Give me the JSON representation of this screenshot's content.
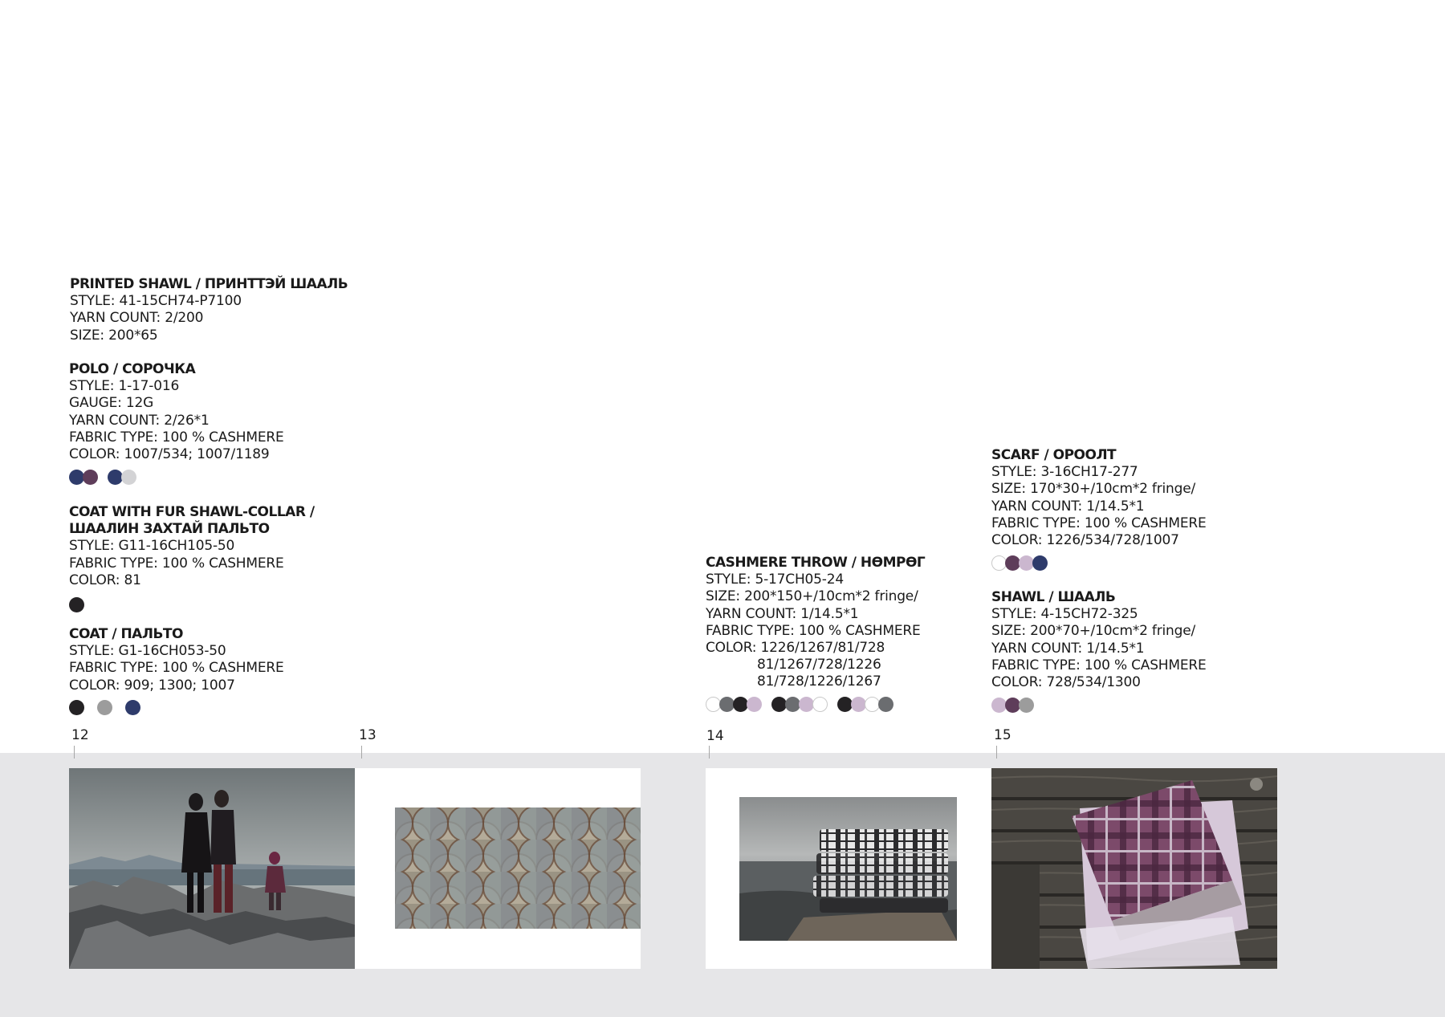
{
  "products": {
    "printed_shawl": {
      "title": "PRINTED SHAWL / ПРИНТТЭЙ ШААЛЬ",
      "style": "STYLE: 41-15CH74-P7100",
      "yarn": "YARN COUNT: 2/200",
      "size": "SIZE: 200*65"
    },
    "polo": {
      "title": "POLO / СОРОЧКА",
      "style": "STYLE: 1-17-016",
      "gauge": "GAUGE: 12G",
      "yarn": "YARN COUNT: 2/26*1",
      "fabric": "FABRIC TYPE: 100 % CASHMERE",
      "color": "COLOR: 1007/534; 1007/1189"
    },
    "coat_fur": {
      "title1": "COAT WITH FUR SHAWL-COLLAR /",
      "title2": "ШААЛИН ЗАХТАЙ ПАЛЬТО",
      "style": "STYLE: G11-16CH105-50",
      "fabric": "FABRIC TYPE: 100 % CASHMERE",
      "color": "COLOR: 81"
    },
    "coat": {
      "title": "COAT / ПАЛЬТО",
      "style": "STYLE: G1-16CH053-50",
      "fabric": "FABRIC TYPE: 100 % CASHMERE",
      "color": "COLOR: 909; 1300; 1007"
    },
    "throw": {
      "title": "CASHMERE THROW / НӨМРӨГ",
      "style": "STYLE: 5-17CH05-24",
      "size": "SIZE: 200*150+/10cm*2 fringe/",
      "yarn": "YARN COUNT: 1/14.5*1",
      "fabric": "FABRIC TYPE: 100 % CASHMERE",
      "color1": "COLOR: 1226/1267/81/728",
      "color2": "81/1267/728/1226",
      "color3": "81/728/1226/1267"
    },
    "scarf": {
      "title": "SCARF / ОРООЛТ",
      "style": "STYLE: 3-16CH17-277",
      "size": "SIZE: 170*30+/10cm*2 fringe/",
      "yarn": "YARN COUNT: 1/14.5*1",
      "fabric": "FABRIC TYPE: 100 % CASHMERE",
      "color": "COLOR: 1226/534/728/1007"
    },
    "shawl": {
      "title": "SHAWL / ШААЛЬ",
      "style": "STYLE: 4-15CH72-325",
      "size": "SIZE: 200*70+/10cm*2 fringe/",
      "yarn": "YARN COUNT: 1/14.5*1",
      "fabric": "FABRIC TYPE: 100 % CASHMERE",
      "color": "COLOR: 728/534/1300"
    }
  },
  "page_numbers": [
    "12",
    "13",
    "14",
    "15"
  ],
  "colors": {
    "navy": "#2e3b6b",
    "plum": "#5e3d5a",
    "light_grey": "#d3d3d5",
    "black": "#242224",
    "mid_grey": "#9c9c9c",
    "dark_grey": "#6b6d70",
    "lavender": "#cbb7cf",
    "white": "#ffffff"
  },
  "swatches": {
    "polo": [
      [
        "navy",
        "plum"
      ],
      [
        "navy",
        "light_grey"
      ]
    ],
    "coat_fur": [
      [
        "black"
      ]
    ],
    "coat": [
      [
        "black"
      ],
      [
        "mid_grey"
      ],
      [
        "navy"
      ]
    ],
    "throw": [
      [
        "white",
        "dark_grey",
        "black",
        "lavender"
      ],
      [
        "black",
        "dark_grey",
        "lavender",
        "white"
      ],
      [
        "black",
        "lavender",
        "white",
        "dark_grey"
      ]
    ],
    "scarf": [
      [
        "white",
        "plum",
        "lavender",
        "navy"
      ]
    ],
    "shawl": [
      [
        "lavender",
        "plum",
        "mid_grey"
      ]
    ]
  }
}
